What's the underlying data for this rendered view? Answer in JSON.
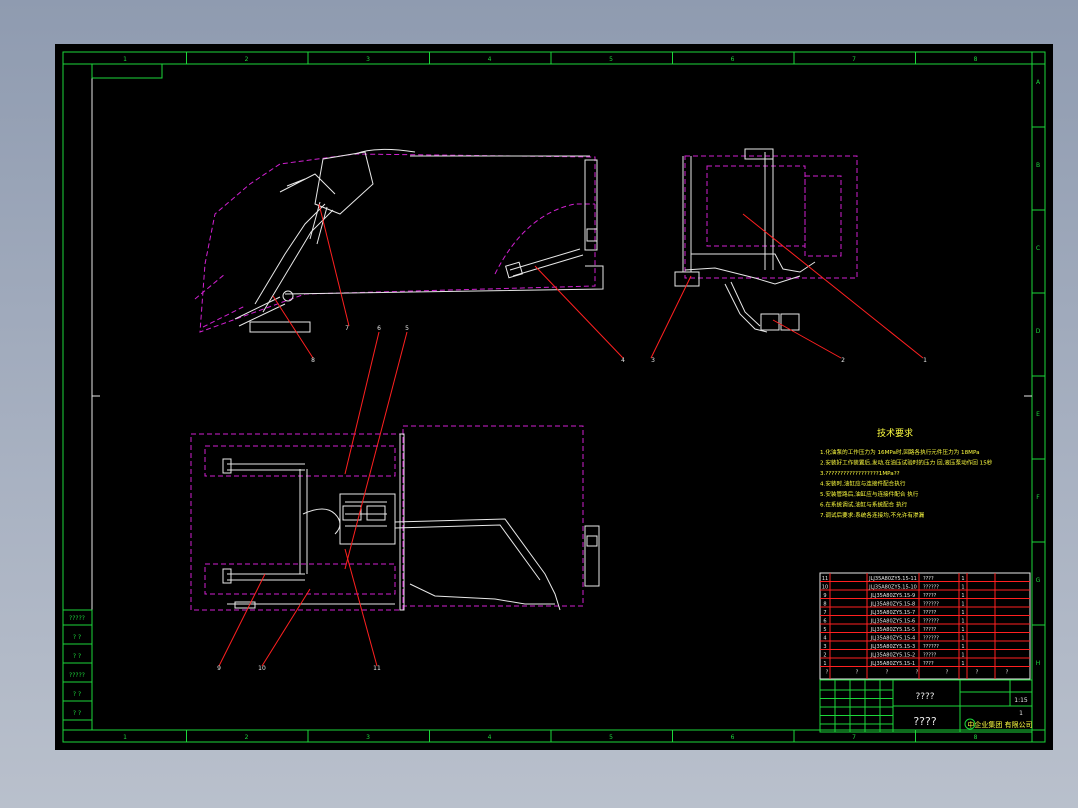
{
  "tech_requirements": {
    "title": "技术要求",
    "lines": [
      "1.化油泵的工作压力为 16MPa时,回路各执行元件压力为 18MPa",
      "2.安装好工作装置后,发动,在油压试验时的压力 回,液压泵动作回 15秒",
      "3.??????????????????1MPa??",
      "4.安装时,油缸应与连接件配合执行",
      "5.安装管路后,油缸应与连接件配合 执行",
      "6.在系统调试,油缸与系统配合 执行",
      "7.调试后要求:系统各连接均,不允许有渗漏"
    ]
  },
  "grid": {
    "columns": [
      "1",
      "2",
      "3",
      "4",
      "5",
      "6",
      "7",
      "8"
    ],
    "rows": [
      "A",
      "B",
      "C",
      "D",
      "E",
      "F",
      "G",
      "H"
    ]
  },
  "callouts": [
    "1",
    "2",
    "3",
    "4",
    "5",
    "6",
    "7",
    "8",
    "9",
    "10",
    "11"
  ],
  "bom": {
    "rows": [
      {
        "no": "11",
        "code": "JLJ35A80ZY5.15-11",
        "name": "????",
        "qty": "1"
      },
      {
        "no": "10",
        "code": "JLJ35A80ZY5.15-10",
        "name": "??????",
        "qty": "1"
      },
      {
        "no": "9",
        "code": "JLJ35A80ZY5.15-9",
        "name": "?????",
        "qty": "1"
      },
      {
        "no": "8",
        "code": "JLJ35A80ZY5.15-8",
        "name": "??????",
        "qty": "1"
      },
      {
        "no": "7",
        "code": "JLJ35A80ZY5.15-7",
        "name": "?????",
        "qty": "1"
      },
      {
        "no": "6",
        "code": "JLJ35A80ZY5.15-6",
        "name": "??????",
        "qty": "1"
      },
      {
        "no": "5",
        "code": "JLJ35A80ZY5.15-5",
        "name": "?????",
        "qty": "1"
      },
      {
        "no": "4",
        "code": "JLJ35A80ZY5.15-4",
        "name": "??????",
        "qty": "1"
      },
      {
        "no": "3",
        "code": "JLJ35A80ZY5.15-3",
        "name": "??????",
        "qty": "1"
      },
      {
        "no": "2",
        "code": "JLJ35A80ZY5.15-2",
        "name": "?????",
        "qty": "1"
      },
      {
        "no": "1",
        "code": "JLJ35A80ZY5.15-1",
        "name": "????",
        "qty": "1"
      }
    ],
    "header": [
      "?",
      "?",
      "?",
      "?",
      "?",
      "?",
      "?"
    ]
  },
  "title_block": {
    "drawing_name": "????",
    "part_name": "????",
    "company": "中企业集团 有限公司",
    "scale": "1:15",
    "sheet": "1"
  },
  "left_block": [
    "?????",
    "? ?",
    "? ?",
    "?????",
    "? ?",
    "? ?"
  ]
}
